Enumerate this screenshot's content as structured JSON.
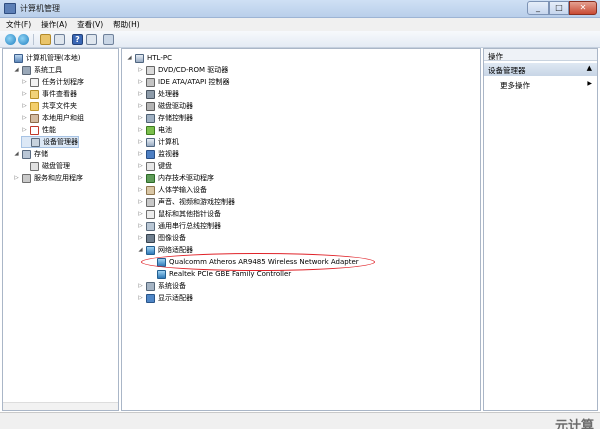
{
  "window": {
    "title": "计算机管理",
    "min_label": "_",
    "max_label": "□",
    "close_label": "✕"
  },
  "menu": [
    "文件(F)",
    "操作(A)",
    "查看(V)",
    "帮助(H)"
  ],
  "left_tree": [
    {
      "label": "计算机管理(本地)",
      "icon": "computer-management-icon",
      "level": 0,
      "expander": ""
    },
    {
      "label": "系统工具",
      "icon": "system-tools-icon",
      "level": 1,
      "expander": "◢"
    },
    {
      "label": "任务计划程序",
      "icon": "clock-icon",
      "level": 2,
      "expander": "▷"
    },
    {
      "label": "事件查看器",
      "icon": "event-viewer-icon",
      "level": 2,
      "expander": "▷"
    },
    {
      "label": "共享文件夹",
      "icon": "shared-folder-icon",
      "level": 2,
      "expander": "▷"
    },
    {
      "label": "本地用户和组",
      "icon": "users-icon",
      "level": 2,
      "expander": "▷"
    },
    {
      "label": "性能",
      "icon": "performance-icon",
      "level": 2,
      "expander": "▷"
    },
    {
      "label": "设备管理器",
      "icon": "device-manager-icon",
      "level": 2,
      "expander": "",
      "selected": true
    },
    {
      "label": "存储",
      "icon": "storage-icon",
      "level": 1,
      "expander": "◢"
    },
    {
      "label": "磁盘管理",
      "icon": "disk-icon",
      "level": 2,
      "expander": ""
    },
    {
      "label": "服务和应用程序",
      "icon": "services-icon",
      "level": 1,
      "expander": "▷"
    }
  ],
  "device_tree": [
    {
      "label": "HTL-PC",
      "icon": "computer-icon",
      "level": 0,
      "expander": "◢"
    },
    {
      "label": "DVD/CD-ROM 驱动器",
      "icon": "dvd-icon",
      "level": 1,
      "expander": "▷"
    },
    {
      "label": "IDE ATA/ATAPI 控制器",
      "icon": "ide-icon",
      "level": 1,
      "expander": "▷"
    },
    {
      "label": "处理器",
      "icon": "cpu-icon",
      "level": 1,
      "expander": "▷"
    },
    {
      "label": "磁盘驱动器",
      "icon": "hdd-icon",
      "level": 1,
      "expander": "▷"
    },
    {
      "label": "存储控制器",
      "icon": "storage-controller-icon",
      "level": 1,
      "expander": "▷"
    },
    {
      "label": "电池",
      "icon": "battery-icon",
      "level": 1,
      "expander": "▷"
    },
    {
      "label": "计算机",
      "icon": "pc-icon",
      "level": 1,
      "expander": "▷"
    },
    {
      "label": "监视器",
      "icon": "monitor-icon",
      "level": 1,
      "expander": "▷"
    },
    {
      "label": "键盘",
      "icon": "keyboard-icon",
      "level": 1,
      "expander": "▷"
    },
    {
      "label": "内存技术驱动程序",
      "icon": "memory-icon",
      "level": 1,
      "expander": "▷"
    },
    {
      "label": "人体学输入设备",
      "icon": "hid-icon",
      "level": 1,
      "expander": "▷"
    },
    {
      "label": "声音、视频和游戏控制器",
      "icon": "sound-icon",
      "level": 1,
      "expander": "▷"
    },
    {
      "label": "鼠标和其他指针设备",
      "icon": "mouse-icon",
      "level": 1,
      "expander": "▷"
    },
    {
      "label": "通用串行总线控制器",
      "icon": "usb-icon",
      "level": 1,
      "expander": "▷"
    },
    {
      "label": "图像设备",
      "icon": "camera-icon",
      "level": 1,
      "expander": "▷"
    },
    {
      "label": "网络适配器",
      "icon": "network-adapter-icon",
      "level": 1,
      "expander": "◢"
    },
    {
      "label": "Qualcomm Atheros AR9485 Wireless Network Adapter",
      "icon": "network-adapter-icon",
      "level": 2,
      "expander": ""
    },
    {
      "label": "Realtek PCIe GBE Family Controller",
      "icon": "network-adapter-icon",
      "level": 2,
      "expander": ""
    },
    {
      "label": "系统设备",
      "icon": "system-devices-icon",
      "level": 1,
      "expander": "▷"
    },
    {
      "label": "显示适配器",
      "icon": "display-adapter-icon",
      "level": 1,
      "expander": "▷"
    }
  ],
  "actions": {
    "header": "操作",
    "section": "设备管理器",
    "more": "更多操作"
  },
  "watermark": "元计算"
}
